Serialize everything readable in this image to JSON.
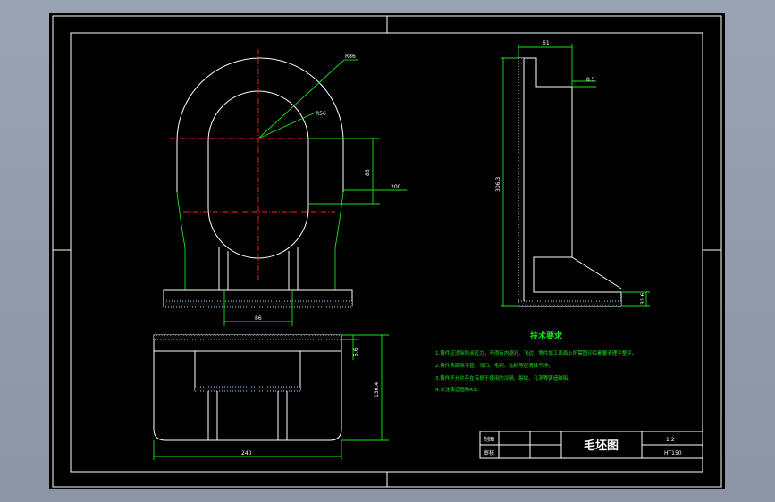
{
  "dimensions": {
    "radius_r": "R86",
    "radius_small": "R56",
    "height_right": "86",
    "width_200": "200",
    "width_bottom": "86",
    "side_top": "61",
    "side_step": "8.5",
    "side_height": "306.3",
    "side_base": "31.6",
    "front_width": "240",
    "front_height": "136.4",
    "front_small": "5.6"
  },
  "tech": {
    "title": "技术要求",
    "lines": [
      "1.铸件应消除残余应力，不得有内缩孔、飞边，零件加工表面上所需图印后都要清理平整平。",
      "2.铸件表面除平整，浇口、毛刺、粘砂等应清除干净。",
      "3.铸件不允许存在有损于使用的冷隔、裂纹、孔洞等铸造缺陷。",
      "4.未注铸造圆角R3。"
    ]
  },
  "titleblock": {
    "label_draw": "制图",
    "label_check": "审核",
    "drawing_name": "毛坯图",
    "scale": "1:2",
    "material": "HT150"
  }
}
